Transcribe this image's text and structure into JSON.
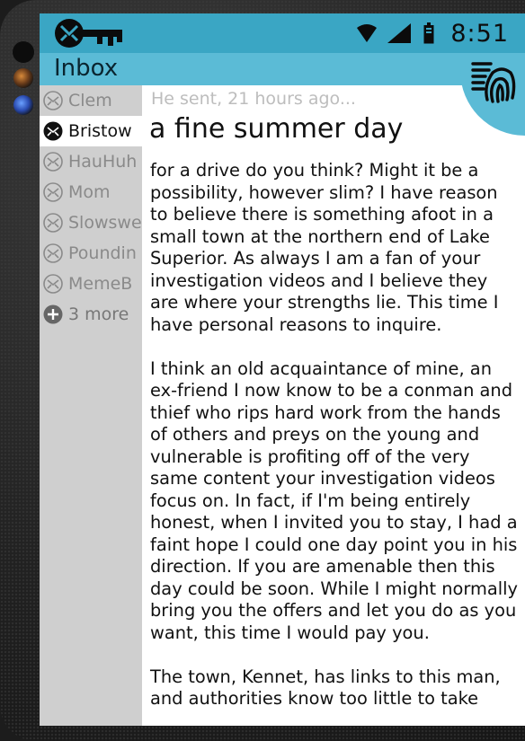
{
  "status": {
    "time": "8:51"
  },
  "header": {
    "title": "Inbox"
  },
  "sidebar": {
    "contacts": [
      {
        "name": "Clem",
        "active": false
      },
      {
        "name": "Bristow",
        "active": true
      },
      {
        "name": "HauHuh",
        "active": false
      },
      {
        "name": "Mom",
        "active": false
      },
      {
        "name": "Slowswe",
        "active": false
      },
      {
        "name": "Poundin",
        "active": false
      },
      {
        "name": "MemeB",
        "active": false
      }
    ],
    "more_label": "3 more"
  },
  "message": {
    "meta": "He sent, 21 hours ago...",
    "subject": "a fine summer day",
    "body": "for a drive do you think? Might it be a possibility, however slim?  I have reason to believe there is something afoot in a small town at the northern end of Lake Superior.  As always I am a fan of your investigation videos and I believe they are where your strengths lie.  This time I have personal reasons to inquire.\n\nI think an old acquaintance of mine, an ex-friend I now know to be a conman and thief who rips hard work from the hands of others and preys on the young and vulnerable is profiting off of the very same content your investigation videos focus on.  In fact, if I'm being entirely honest, when I invited you to stay, I had a faint hope I could one day point you in his direction.  If you are amenable then this day could be soon.  While I might normally bring you the offers and let you do as you want, this time I would pay you.\n\nThe town, Kennet, has links to this man, and authorities know too little to take"
  },
  "colors": {
    "statusbar": "#3aa6c4",
    "header": "#5bbbd6",
    "sidebar": "#cfcfcf"
  }
}
